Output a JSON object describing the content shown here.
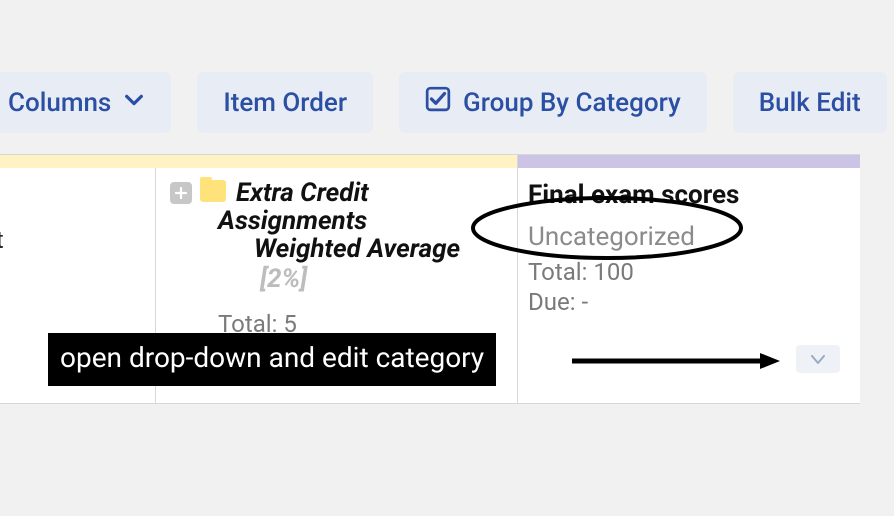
{
  "toolbar": {
    "columns_label": "Columns",
    "item_order_label": "Item Order",
    "group_by_label": "Group By Category",
    "bulk_edit_label": "Bulk Edit"
  },
  "left_column": {
    "partial_text": "it"
  },
  "mid_column": {
    "title_line1": "Extra Credit",
    "title_line2": "Assignments",
    "title_line3": "Weighted Average",
    "percent_label": "[2%]",
    "total_label": "Total: 5"
  },
  "right_column": {
    "title": "Final exam scores",
    "category": "Uncategorized",
    "total_label": "Total: 100",
    "due_label": "Due: -"
  },
  "annotation": {
    "label": "open drop-down and edit category"
  }
}
